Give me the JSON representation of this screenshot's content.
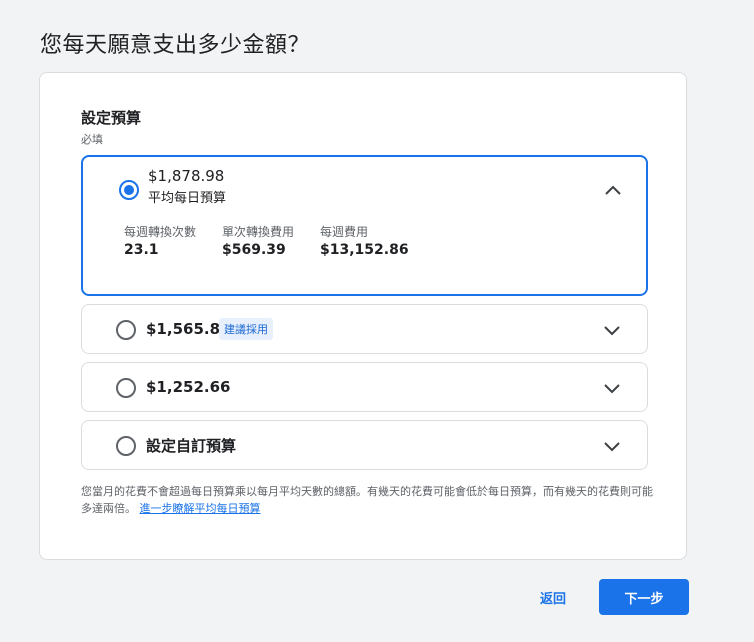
{
  "page_title": "您每天願意支出多少金額？",
  "budget_section": {
    "title": "設定預算",
    "required": "必填",
    "options": [
      {
        "amount": "$1,878.98",
        "subtitle": "平均每日預算",
        "selected": true,
        "expanded": true,
        "stats": [
          {
            "label": "每週轉換次數",
            "value": "23.1"
          },
          {
            "label": "單次轉換費用",
            "value": "$569.39"
          },
          {
            "label": "每週費用",
            "value": "$13,152.86"
          }
        ]
      },
      {
        "amount": "$1,565.82",
        "badge": "建議採用",
        "selected": false
      },
      {
        "amount": "$1,252.66",
        "selected": false
      },
      {
        "amount": "設定自訂預算",
        "selected": false
      }
    ],
    "note_text": "您當月的花費不會超過每日預算乘以每月平均天數的總額。有幾天的花費可能會低於每日預算，而有幾天的花費則可能多達兩倍。",
    "note_link": "進一步瞭解平均每日預算"
  },
  "footer": {
    "back_label": "返回",
    "next_label": "下一步"
  },
  "colors": {
    "accent": "#1a73e8",
    "background": "#f1f3f4"
  }
}
